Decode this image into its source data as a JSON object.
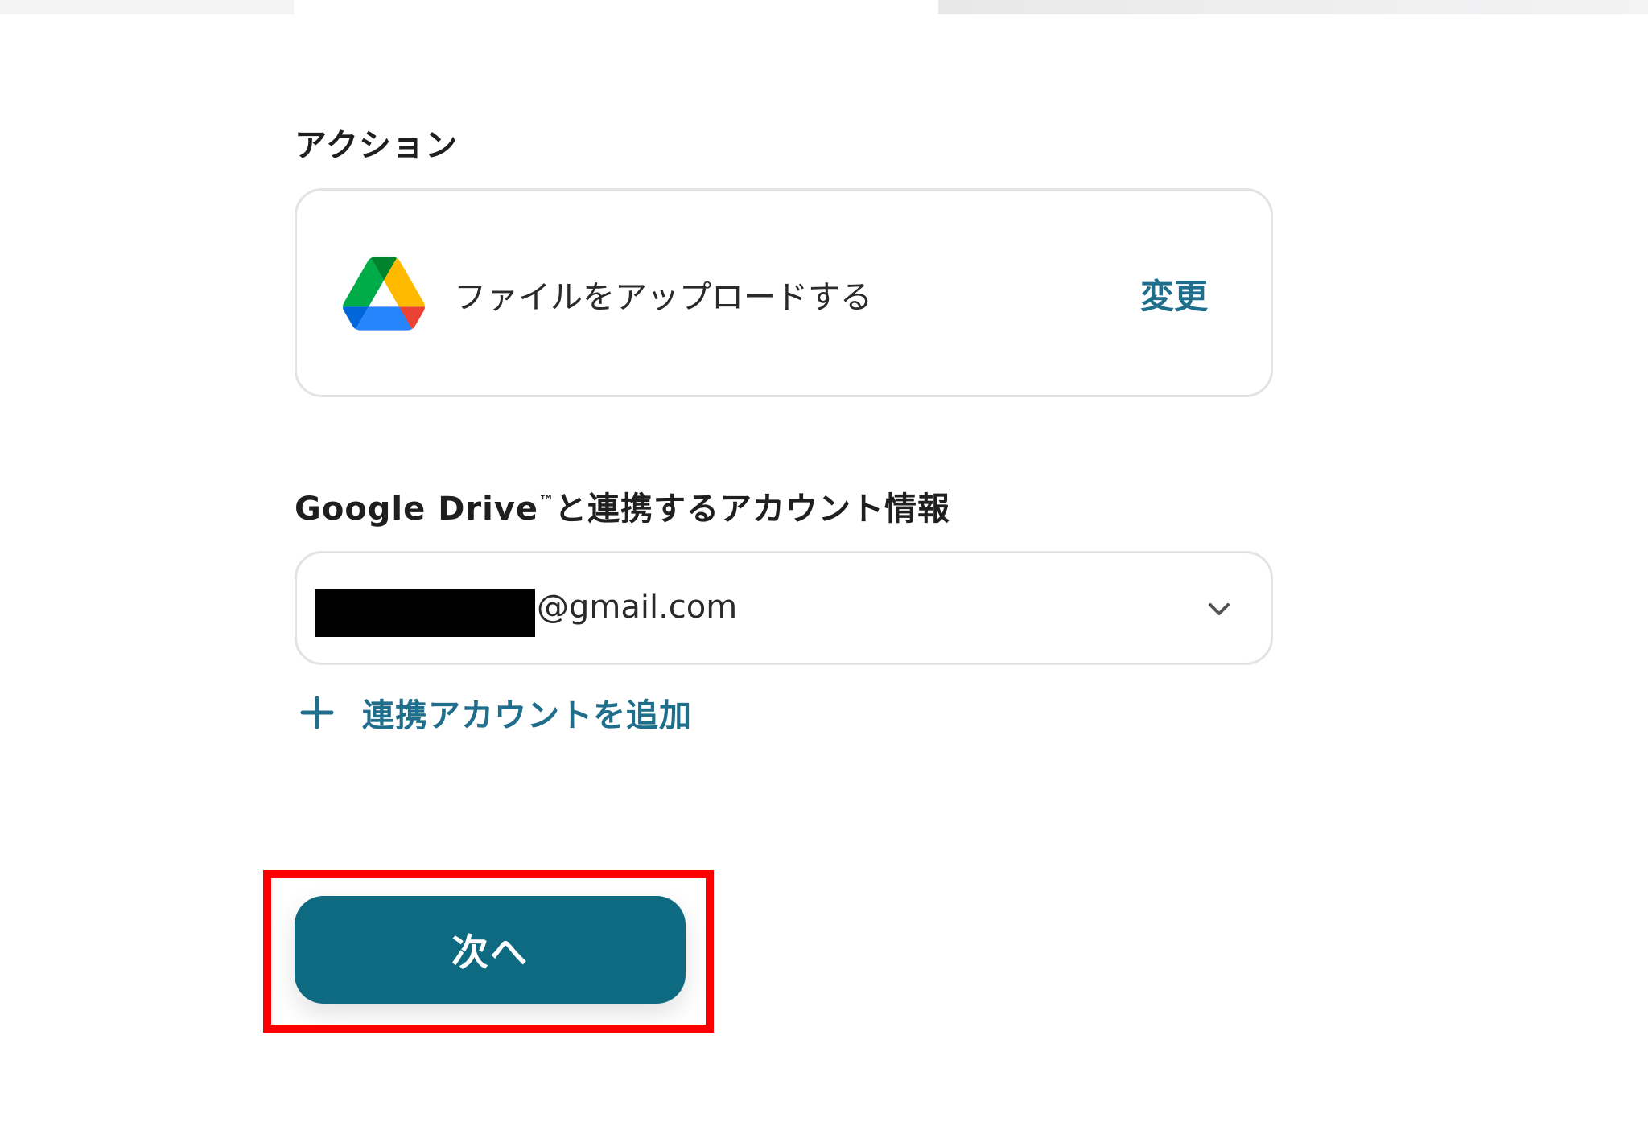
{
  "sections": {
    "action_label": "アクション",
    "account_label": "Google Drive",
    "account_label_tm": "™",
    "account_label_suffix": "と連携するアカウント情報"
  },
  "action_card": {
    "icon": "google-drive-icon",
    "action_name": "ファイルをアップロードする",
    "change_label": "変更"
  },
  "account_select": {
    "selected_email_visible": "@gmail.com",
    "redacted": true
  },
  "add_account": {
    "icon": "plus-icon",
    "label": "連携アカウントを追加"
  },
  "footer": {
    "next_label": "次へ"
  },
  "colors": {
    "accent": "#1f6e8c",
    "button_bg": "#0e6a80",
    "highlight": "#ff0000",
    "border": "#e3e3e3"
  }
}
